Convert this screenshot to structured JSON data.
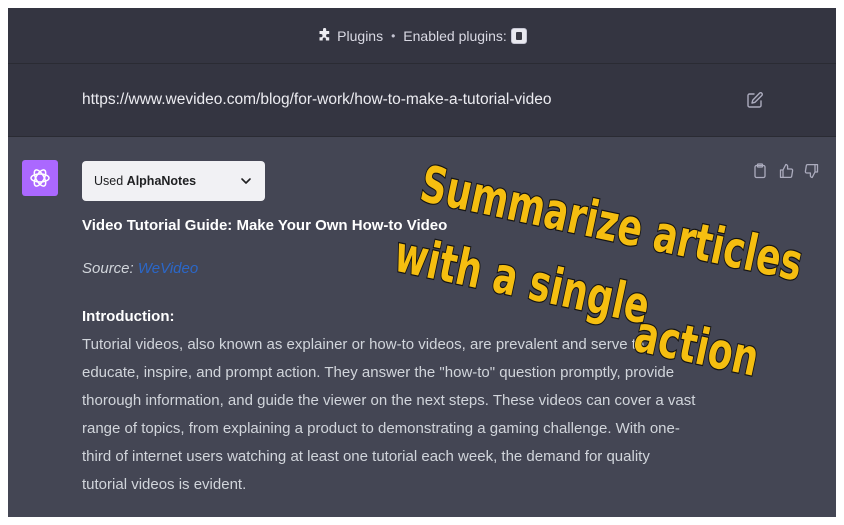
{
  "header": {
    "plugins_label": "Plugins",
    "separator": "•",
    "enabled_label": "Enabled plugins:",
    "icons": {
      "plugins": "puzzle-icon",
      "enabled_plugin": "alphanotes-plugin-icon"
    }
  },
  "user_message": {
    "text": "https://www.wevideo.com/blog/for-work/how-to-make-a-tutorial-video",
    "edit_icon": "edit-icon"
  },
  "assistant": {
    "avatar_icon": "openai-logo-icon",
    "accent": "#ab68ff",
    "used_plugin": {
      "prefix": "Used",
      "name": "AlphaNotes",
      "icon": "chevron-down-icon"
    },
    "actions": [
      "clipboard-icon",
      "thumbs-up-icon",
      "thumbs-down-icon"
    ],
    "title": "Video Tutorial Guide: Make Your Own How-to Video",
    "source_label": "Source:",
    "source_link": "WeVideo",
    "intro_heading": "Introduction:",
    "intro_lines": [
      "Tutorial videos, also known as explainer or how-to videos, are prevalent and serve to",
      "educate, inspire, and prompt action. They answer the \"how-to\" question promptly, provide",
      "thorough information, and guide the viewer on the next steps. These videos can cover a vast",
      "range of topics, from explaining a product to demonstrating a gaming challenge. With one-",
      "third of internet users watching at least one tutorial each week, the demand for quality",
      "tutorial videos is evident."
    ]
  },
  "overlay": {
    "lines": [
      "Summarize articles",
      "with a single",
      "action"
    ],
    "color": "#f5be10"
  }
}
